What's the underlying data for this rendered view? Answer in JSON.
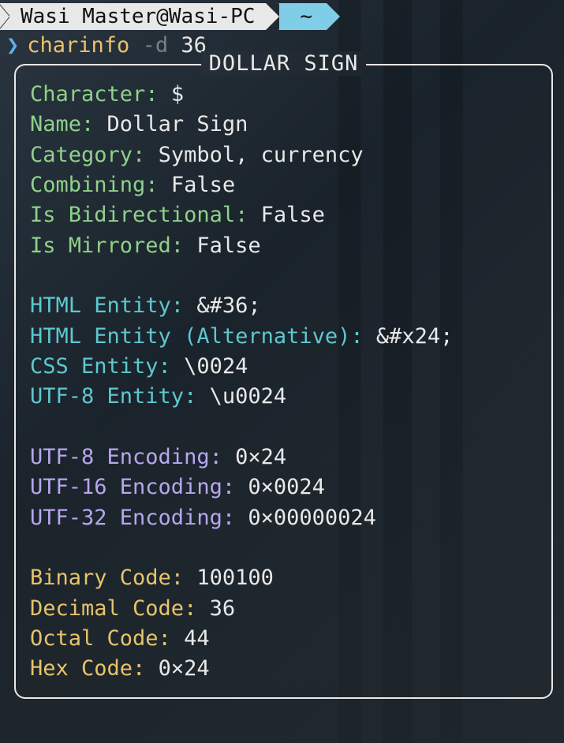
{
  "prompt": {
    "user_host": "Wasi Master@Wasi-PC",
    "path": "~",
    "caret": "❯",
    "command": "charinfo",
    "flag": "-d",
    "arg": "36"
  },
  "box": {
    "title": "DOLLAR SIGN",
    "sections": {
      "basic": {
        "character": {
          "label": "Character:",
          "value": "$"
        },
        "name": {
          "label": "Name:",
          "value": "Dollar Sign"
        },
        "category": {
          "label": "Category:",
          "value": "Symbol, currency"
        },
        "combining": {
          "label": "Combining:",
          "value": "False"
        },
        "bidi": {
          "label": "Is Bidirectional:",
          "value": "False"
        },
        "mirrored": {
          "label": "Is Mirrored:",
          "value": "False"
        }
      },
      "entities": {
        "html": {
          "label": "HTML Entity:",
          "value": "&#36;"
        },
        "html_alt": {
          "label": "HTML Entity (Alternative):",
          "value": "&#x24;"
        },
        "css": {
          "label": "CSS Entity:",
          "value": "\\0024"
        },
        "utf8e": {
          "label": "UTF-8 Entity:",
          "value": "\\u0024"
        }
      },
      "encodings": {
        "utf8": {
          "label": "UTF-8 Encoding:",
          "value": "0×24"
        },
        "utf16": {
          "label": "UTF-16 Encoding:",
          "value": "0×0024"
        },
        "utf32": {
          "label": "UTF-32 Encoding:",
          "value": "0×00000024"
        }
      },
      "codes": {
        "binary": {
          "label": "Binary Code:",
          "value": "100100"
        },
        "decimal": {
          "label": "Decimal Code:",
          "value": "36"
        },
        "octal": {
          "label": "Octal Code:",
          "value": "44"
        },
        "hex": {
          "label": "Hex Code:",
          "value": "0×24"
        }
      }
    }
  }
}
